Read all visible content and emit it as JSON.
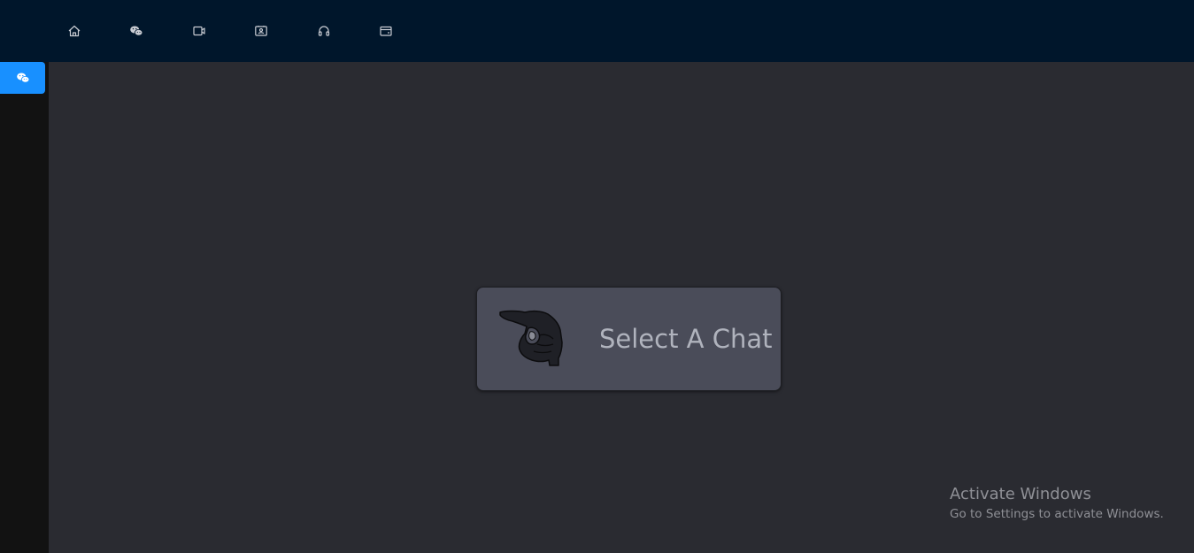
{
  "topnav": {
    "items": [
      {
        "icon": "home-icon"
      },
      {
        "icon": "wechat-icon"
      },
      {
        "icon": "video-icon"
      },
      {
        "icon": "contact-card-icon"
      },
      {
        "icon": "headphones-icon"
      },
      {
        "icon": "wallet-icon"
      }
    ]
  },
  "sidebar": {
    "items": [
      {
        "icon": "wechat-icon",
        "active": true
      }
    ]
  },
  "main": {
    "placeholder_text": "Select A Chat",
    "placeholder_icon": "pointing-hand-icon"
  },
  "watermark": {
    "title": "Activate Windows",
    "subtitle": "Go to Settings to activate Windows."
  },
  "colors": {
    "topbar": "#00162b",
    "sidebar": "#121212",
    "main_bg": "#2a2b31",
    "card_bg": "#4a4c59",
    "accent": "#1890ff"
  }
}
